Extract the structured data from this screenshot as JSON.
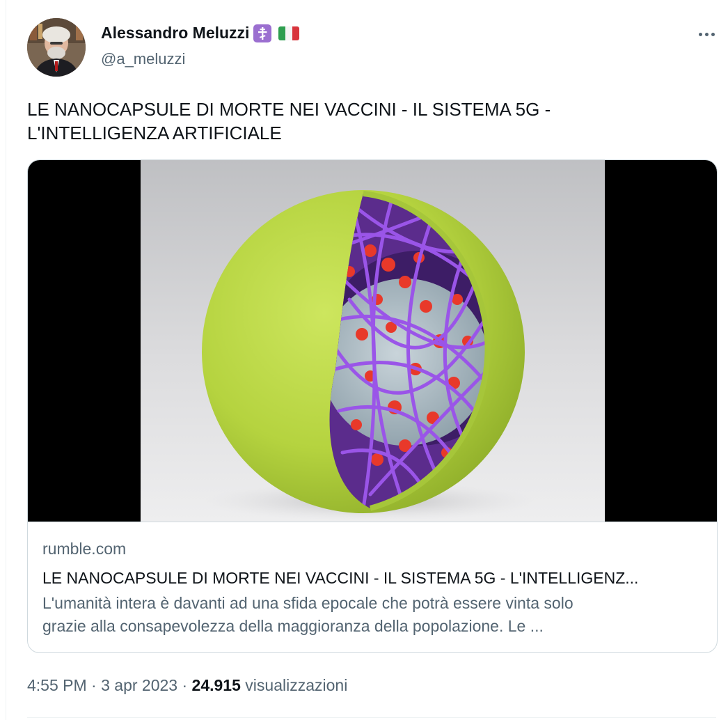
{
  "author": {
    "display_name": "Alessandro Meluzzi",
    "handle": "@a_meluzzi",
    "badges": [
      "orthodox-cross-icon",
      "italy-flag-icon"
    ]
  },
  "tweet": {
    "text_line1": "LE NANOCAPSULE DI MORTE NEI VACCINI - IL SISTEMA 5G -",
    "text_line2": "L'INTELLIGENZA ARTIFICIALE"
  },
  "card": {
    "domain": "rumble.com",
    "title": "LE NANOCAPSULE DI MORTE NEI VACCINI - IL SISTEMA 5G - L'INTELLIGENZ...",
    "description_line1": "L'umanità intera è davanti ad una sfida epocale che potrà essere vinta solo",
    "description_line2": "grazie alla consapevolezza della maggioranza della popolazione. Le ..."
  },
  "meta": {
    "time": "4:55 PM",
    "separator": "·",
    "date": "3 apr 2023",
    "views_count": "24.915",
    "views_label": "visualizzazioni"
  },
  "colors": {
    "text_primary": "#0f1419",
    "text_secondary": "#536471",
    "border": "#cfd9de",
    "sphere_green": "#b5d33f",
    "lattice_purple": "#9a55e8",
    "particle_red": "#e8392a"
  }
}
